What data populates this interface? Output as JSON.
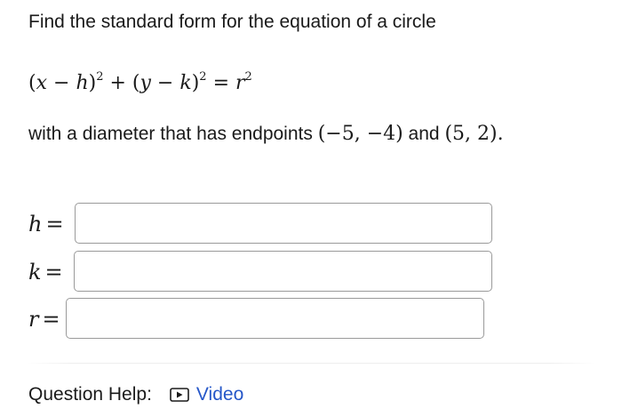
{
  "question": {
    "prompt": "Find the standard form for the equation of a circle",
    "equation": {
      "lhs_open1": "(",
      "x": "x",
      "minus1": " − ",
      "h": "h",
      "close1": ")",
      "sq": "2",
      "plus": " + (",
      "y": "y",
      "minus2": " − ",
      "k": "k",
      "close2": ")",
      "equals": " = ",
      "r": "r"
    },
    "diameter_text_before": "with a diameter that has endpoints ",
    "endpoint1": "(−5, −4)",
    "and_text": " and ",
    "endpoint2": "(5, 2)",
    "period": "."
  },
  "answers": [
    {
      "variable": "h",
      "equals": "=",
      "value": "",
      "placeholder": ""
    },
    {
      "variable": "k",
      "equals": "=",
      "value": "",
      "placeholder": ""
    },
    {
      "variable": "r",
      "equals": "=",
      "value": "",
      "placeholder": ""
    }
  ],
  "help": {
    "label": "Question Help:",
    "video_label": "Video",
    "video_icon": "play-icon",
    "link_color": "#2456c8"
  }
}
